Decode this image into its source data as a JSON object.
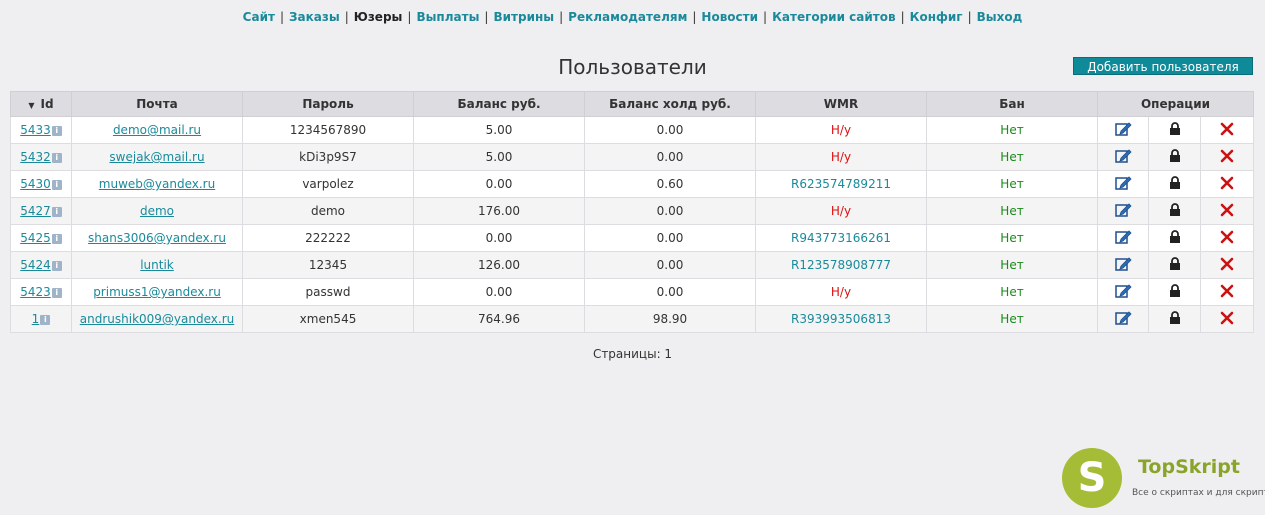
{
  "nav": [
    {
      "label": "Сайт",
      "active": false
    },
    {
      "label": "Заказы",
      "active": false
    },
    {
      "label": "Юзеры",
      "active": true
    },
    {
      "label": "Выплаты",
      "active": false
    },
    {
      "label": "Витрины",
      "active": false
    },
    {
      "label": "Рекламодателям",
      "active": false
    },
    {
      "label": "Новости",
      "active": false
    },
    {
      "label": "Категории сайтов",
      "active": false
    },
    {
      "label": "Конфиг",
      "active": false
    },
    {
      "label": "Выход",
      "active": false
    }
  ],
  "nav_separator": "|",
  "page_title": "Пользователи",
  "add_user_label": "Добавить пользователя",
  "columns": [
    "Id",
    "Почта",
    "Пароль",
    "Баланс руб.",
    "Баланс холд руб.",
    "WMR",
    "Бан",
    "Операции"
  ],
  "rows": [
    {
      "id": "5433",
      "email": "demo@mail.ru",
      "password": "1234567890",
      "balance": "5.00",
      "hold": "0.00",
      "wmr": "Н/у",
      "wmr_set": false,
      "ban": "Нет"
    },
    {
      "id": "5432",
      "email": "swejak@mail.ru",
      "password": "kDi3p9S7",
      "balance": "5.00",
      "hold": "0.00",
      "wmr": "Н/у",
      "wmr_set": false,
      "ban": "Нет"
    },
    {
      "id": "5430",
      "email": "muweb@yandex.ru",
      "password": "varpolez",
      "balance": "0.00",
      "hold": "0.60",
      "wmr": "R623574789211",
      "wmr_set": true,
      "ban": "Нет"
    },
    {
      "id": "5427",
      "email": "demo",
      "password": "demo",
      "balance": "176.00",
      "hold": "0.00",
      "wmr": "Н/у",
      "wmr_set": false,
      "ban": "Нет"
    },
    {
      "id": "5425",
      "email": "shans3006@yandex.ru",
      "password": "222222",
      "balance": "0.00",
      "hold": "0.00",
      "wmr": "R943773166261",
      "wmr_set": true,
      "ban": "Нет"
    },
    {
      "id": "5424",
      "email": "luntik",
      "password": "12345",
      "balance": "126.00",
      "hold": "0.00",
      "wmr": "R123578908777",
      "wmr_set": true,
      "ban": "Нет"
    },
    {
      "id": "5423",
      "email": "primuss1@yandex.ru",
      "password": "passwd",
      "balance": "0.00",
      "hold": "0.00",
      "wmr": "Н/у",
      "wmr_set": false,
      "ban": "Нет"
    },
    {
      "id": "1",
      "email": "andrushik009@yandex.ru",
      "password": "xmen545",
      "balance": "764.96",
      "hold": "98.90",
      "wmr": "R393993506813",
      "wmr_set": true,
      "ban": "Нет"
    }
  ],
  "pages_text": "Страницы: 1",
  "icons": {
    "info": "info-icon",
    "edit": "edit-icon",
    "lock": "lock-icon",
    "delete": "delete-icon",
    "sort": "sort-desc-icon"
  },
  "colors": {
    "link": "#1a8a9b",
    "button": "#0e8a99",
    "no_wmr": "#dd1111",
    "ban_no": "#1a8a1a",
    "delete": "#cc1111"
  },
  "logo": {
    "letter": "S",
    "name": "TopSkript",
    "tagline": "Все о скриптах и для скриптов..."
  }
}
